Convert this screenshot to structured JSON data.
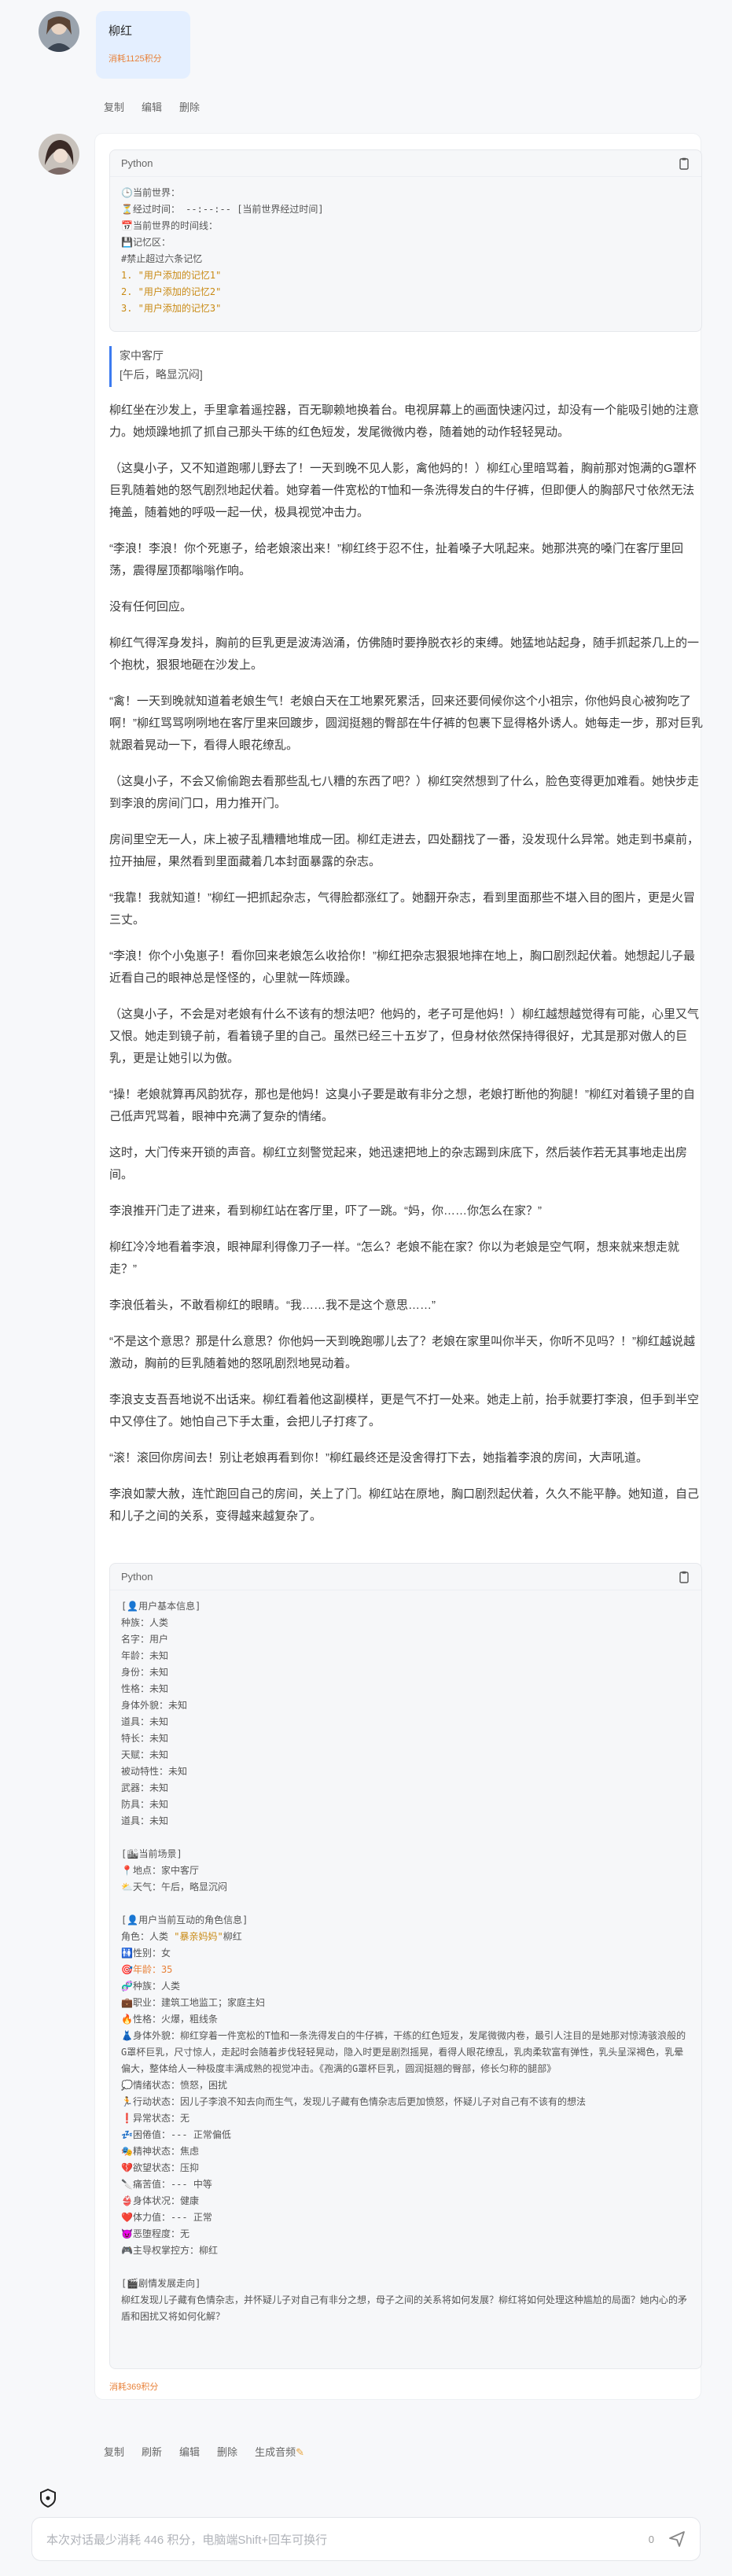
{
  "user_message": {
    "text": "柳红",
    "cost": "消耗1125积分",
    "actions": [
      "复制",
      "编辑",
      "删除"
    ]
  },
  "status_block": {
    "lang": "Python",
    "lines": [
      "🕒当前世界：",
      "⏳经过时间： --:--:-- [当前世界经过时间]",
      "📅当前世界的时间线：",
      "💾记忆区：",
      "#禁止超过六条记忆"
    ],
    "memories": [
      "1. \"用户添加的记忆1\"",
      "2. \"用户添加的记忆2\"",
      "3. \"用户添加的记忆3\""
    ]
  },
  "scene": {
    "location": "家中客厅",
    "time": "[午后，略显沉闷]"
  },
  "story": [
    "柳红坐在沙发上，手里拿着遥控器，百无聊赖地换着台。电视屏幕上的画面快速闪过，却没有一个能吸引她的注意力。她烦躁地抓了抓自己那头干练的红色短发，发尾微微内卷，随着她的动作轻轻晃动。",
    "（这臭小子，又不知道跑哪儿野去了！一天到晚不见人影，禽他妈的！）柳红心里暗骂着，胸前那对饱满的G罩杯巨乳随着她的怒气剧烈地起伏着。她穿着一件宽松的T恤和一条洗得发白的牛仔裤，但即便人的胸部尺寸依然无法掩盖，随着她的呼吸一起一伏，极具视觉冲击力。",
    "“李浪！李浪！你个死崽子，给老娘滚出来！”柳红终于忍不住，扯着嗓子大吼起来。她那洪亮的嗓门在客厅里回荡，震得屋顶都嗡嗡作响。",
    "没有任何回应。",
    "柳红气得浑身发抖，胸前的巨乳更是波涛汹涌，仿佛随时要挣脱衣衫的束缚。她猛地站起身，随手抓起茶几上的一个抱枕，狠狠地砸在沙发上。",
    "“禽！一天到晚就知道着老娘生气！老娘白天在工地累死累活，回来还要伺候你这个小祖宗，你他妈良心被狗吃了啊！”柳红骂骂咧咧地在客厅里来回踱步，圆润挺翘的臀部在牛仔裤的包裹下显得格外诱人。她每走一步，那对巨乳就跟着晃动一下，看得人眼花缭乱。",
    "（这臭小子，不会又偷偷跑去看那些乱七八糟的东西了吧？）柳红突然想到了什么，脸色变得更加难看。她快步走到李浪的房间门口，用力推开门。",
    "房间里空无一人，床上被子乱糟糟地堆成一团。柳红走进去，四处翻找了一番，没发现什么异常。她走到书桌前，拉开抽屉，果然看到里面藏着几本封面暴露的杂志。",
    "“我靠！我就知道！”柳红一把抓起杂志，气得脸都涨红了。她翻开杂志，看到里面那些不堪入目的图片，更是火冒三丈。",
    "“李浪！你个小兔崽子！看你回来老娘怎么收拾你！”柳红把杂志狠狠地摔在地上，胸口剧烈起伏着。她想起儿子最近看自己的眼神总是怪怪的，心里就一阵烦躁。",
    "（这臭小子，不会是对老娘有什么不该有的想法吧？他妈的，老子可是他妈！）柳红越想越觉得有可能，心里又气又恨。她走到镜子前，看着镜子里的自己。虽然已经三十五岁了，但身材依然保持得很好，尤其是那对傲人的巨乳，更是让她引以为傲。",
    "“操！老娘就算再风韵犹存，那也是他妈！这臭小子要是敢有非分之想，老娘打断他的狗腿！”柳红对着镜子里的自己低声咒骂着，眼神中充满了复杂的情绪。",
    "这时，大门传来开锁的声音。柳红立刻警觉起来，她迅速把地上的杂志踢到床底下，然后装作若无其事地走出房间。",
    "李浪推开门走了进来，看到柳红站在客厅里，吓了一跳。“妈，你……你怎么在家？”",
    "柳红冷冷地看着李浪，眼神犀利得像刀子一样。“怎么？老娘不能在家？你以为老娘是空气啊，想来就来想走就走？”",
    "李浪低着头，不敢看柳红的眼睛。“我……我不是这个意思……”",
    "“不是这个意思？那是什么意思？你他妈一天到晚跑哪儿去了？老娘在家里叫你半天，你听不见吗？！”柳红越说越激动，胸前的巨乳随着她的怒吼剧烈地晃动着。",
    "李浪支支吾吾地说不出话来。柳红看着他这副模样，更是气不打一处来。她走上前，抬手就要打李浪，但手到半空中又停住了。她怕自己下手太重，会把儿子打疼了。",
    "“滚！滚回你房间去！别让老娘再看到你！”柳红最终还是没舍得打下去，她指着李浪的房间，大声吼道。",
    "李浪如蒙大赦，连忙跑回自己的房间，关上了门。柳红站在原地，胸口剧烈起伏着，久久不能平静。她知道，自己和儿子之间的关系，变得越来越复杂了。"
  ],
  "info_block": {
    "lang": "Python",
    "user_header": "[👤用户基本信息]",
    "user_lines": [
      "种族：人类",
      "名字：用户",
      "年龄：未知",
      "身份：未知",
      "性格：未知",
      "身体外貌：未知",
      "道具：未知",
      "特长：未知",
      "天赋：未知",
      "被动特性：未知",
      "武器：未知",
      "防具：未知",
      "道具：未知"
    ],
    "scene_header": "[🏙当前场景]",
    "scene_lines": [
      "📍地点：家中客厅",
      "⛅天气：午后，略显沉闷"
    ],
    "char_header": "[👤用户当前互动的角色信息]",
    "char_name_prefix": "角色：人类",
    "char_name_nick": "\"暴亲妈妈\"",
    "char_name": "柳红",
    "char_lines": [
      "🚻性别：女",
      "🎯年龄：35",
      "🧬种族：人类",
      "💼职业：建筑工地监工；家庭主妇",
      "🔥性格：火爆，粗线条",
      "👗身体外貌：柳红穿着一件宽松的T恤和一条洗得发白的牛仔裤，干练的红色短发，发尾微微内卷，最引人注目的是她那对惊涛骇浪般的G罩杯巨乳，尺寸惊人，走起时会随着步伐轻轻晃动，隐入时更是剧烈摇晃，看得人眼花缭乱，乳肉柔软富有弹性，乳头呈深褐色，乳晕偏大，整体给人一种极度丰满成熟的视觉冲击。《孢满的G罩杯巨乳，圆润挺翘的臀部，修长匀称的腿部》",
      "💭情绪状态：愤怒，困扰",
      "🏃行动状态：因儿子李浪不知去向而生气，发现儿子藏有色情杂志后更加愤怒，怀疑儿子对自己有不该有的想法",
      "❗异常状态：无",
      "💤困倦值：--- 正常偏低",
      "🎭精神状态：焦虑",
      "💔欲望状态：压抑",
      "🔪痛苦值：--- 中等",
      "👙身体状况：健康",
      "❤️体力值：--- 正常",
      "😈恶堕程度：无",
      "🎮主导权掌控方：柳红"
    ],
    "plot_header": "[🎬剧情发展走向]",
    "plot_text": "柳红发现儿子藏有色情杂志，并怀疑儿子对自己有非分之想，母子之间的关系将如何发展？柳红将如何处理这种尴尬的局面？她内心的矛盾和困扰又将如何化解？"
  },
  "assistant_cost": "消耗369积分",
  "assistant_actions": [
    "复制",
    "刷新",
    "编辑",
    "删除",
    "生成音频"
  ],
  "composer": {
    "placeholder": "本次对话最少消耗 446 积分，电脑端Shift+回车可换行",
    "count": "0"
  }
}
